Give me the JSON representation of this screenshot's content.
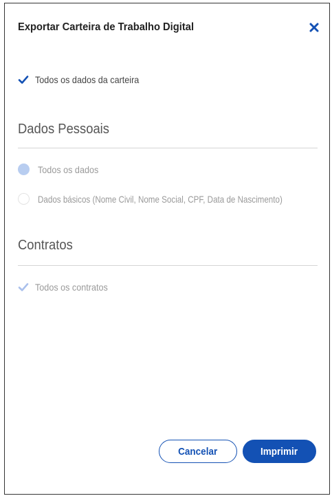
{
  "modal": {
    "title": "Exportar Carteira de Trabalho Digital",
    "close_icon": "close-icon"
  },
  "all_wallet_data": {
    "label": "Todos os dados da carteira",
    "checked": true
  },
  "personal_data": {
    "section_title": "Dados Pessoais",
    "options": [
      {
        "label": "Todos os dados",
        "selected": true
      },
      {
        "label": "Dados básicos (Nome Civil, Nome Social, CPF, Data de Nascimento)",
        "selected": false
      }
    ]
  },
  "contracts": {
    "section_title": "Contratos",
    "all_contracts_label": "Todos os contratos",
    "checked": true,
    "disabled": true
  },
  "actions": {
    "cancel_label": "Cancelar",
    "print_label": "Imprimir"
  },
  "colors": {
    "primary": "#1351b4",
    "disabled_check": "#aac0ec",
    "radio_selected": "#b8cdf0"
  }
}
